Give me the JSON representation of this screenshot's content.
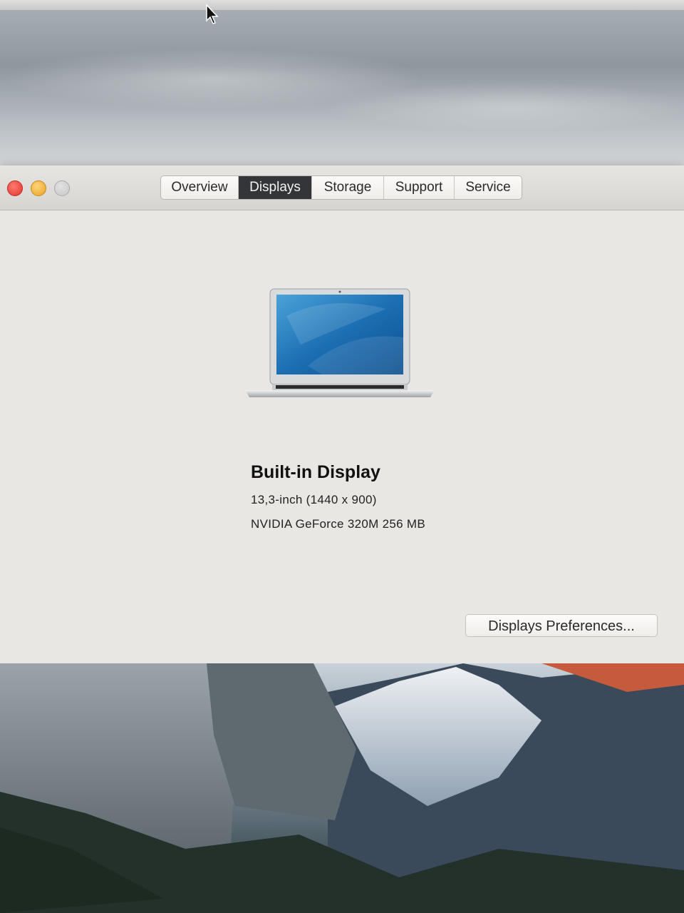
{
  "window": {
    "tabs": [
      {
        "label": "Overview",
        "active": false
      },
      {
        "label": "Displays",
        "active": true
      },
      {
        "label": "Storage",
        "active": false
      },
      {
        "label": "Support",
        "active": false
      },
      {
        "label": "Service",
        "active": false
      }
    ]
  },
  "display": {
    "name": "Built-in Display",
    "size_resolution": "13,3-inch (1440 x 900)",
    "graphics": "NVIDIA GeForce 320M 256 MB"
  },
  "buttons": {
    "preferences_label": "Displays Preferences..."
  },
  "icons": {
    "close": "close-icon",
    "minimize": "minimize-icon",
    "zoom": "zoom-icon",
    "laptop": "laptop-icon",
    "cursor": "mouse-cursor-icon"
  },
  "colors": {
    "window_bg": "#e9e7e3",
    "active_tab_bg": "#333538",
    "close": "#e0362c",
    "minimize": "#e6a323"
  }
}
